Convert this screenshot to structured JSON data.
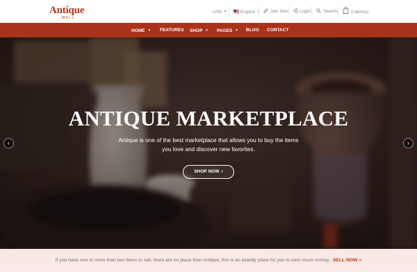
{
  "logo": {
    "main": "Antique",
    "sub": "MALL"
  },
  "topbar": {
    "currency": "USD",
    "language": "English",
    "join": "Join free",
    "login": "Login",
    "search": "Search",
    "cart": "0 item(s)"
  },
  "nav": {
    "items": [
      {
        "label": "HOME",
        "has_dropdown": true
      },
      {
        "label": "FEATURES",
        "has_dropdown": false
      },
      {
        "label": "SHOP",
        "has_dropdown": true
      },
      {
        "label": "PAGES",
        "has_dropdown": true
      },
      {
        "label": "BLOG",
        "has_dropdown": false
      },
      {
        "label": "CONTACT",
        "has_dropdown": false
      }
    ]
  },
  "hero": {
    "title": "ANTIQUE MARKETPLACE",
    "text_line1": "Antique is one of the best marketplace that allows you to buy the items",
    "text_line2": "you love and discover new favorites.",
    "button": "SHOP NOW",
    "prev_icon": "chevron-left-icon",
    "next_icon": "chevron-right-icon"
  },
  "banner": {
    "text": "If you have one or more than two items to sell, there are no place than Antique, this is an exactly place for you to earn much money.",
    "link": "SELL NOW"
  },
  "colors": {
    "brand": "#a8321a",
    "logo": "#b3371b",
    "banner_bg": "#f9e9e6"
  }
}
